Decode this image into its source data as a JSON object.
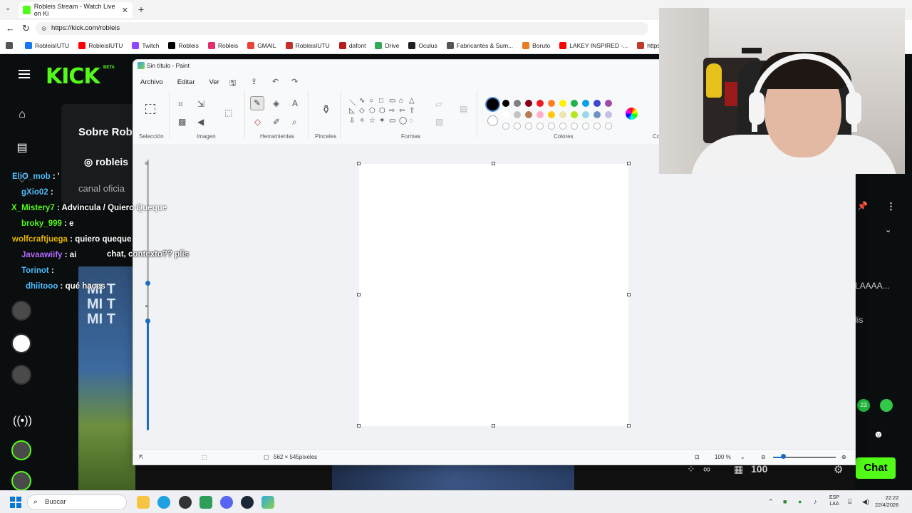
{
  "browser": {
    "tab_title": "Robleis Stream - Watch Live on Ki",
    "url": "https://kick.com/robleis",
    "bookmarks": [
      {
        "label": "RobleisIUTU",
        "color": "#1877f2"
      },
      {
        "label": "RobleisIUTU",
        "color": "#ff0000"
      },
      {
        "label": "Twitch",
        "color": "#9146ff"
      },
      {
        "label": "Robleis",
        "color": "#000000"
      },
      {
        "label": "Robleis",
        "color": "#e1306c"
      },
      {
        "label": "GMAIL",
        "color": "#ea4335"
      },
      {
        "label": "RobleisIUTU",
        "color": "#c4302b"
      },
      {
        "label": "dafont",
        "color": "#b71c1c"
      },
      {
        "label": "Drive",
        "color": "#34a853"
      },
      {
        "label": "Oculus",
        "color": "#1c1e21"
      },
      {
        "label": "Fabricantes & Sum...",
        "color": "#555555"
      },
      {
        "label": "Boruto",
        "color": "#e67e22"
      },
      {
        "label": "LAKEY INSPIRED -...",
        "color": "#ff0000"
      },
      {
        "label": "https://www",
        "color": "#c0392b"
      }
    ]
  },
  "kick": {
    "logo": "KICK",
    "beta": "BETA",
    "about_title": "Sobre Rob",
    "about_ig": "robleis",
    "about_desc": "canal oficia",
    "poster_lines": [
      "MI T",
      "MI T",
      "MI T"
    ],
    "chat": [
      {
        "user": "EliO_mob",
        "msg": ": '",
        "color": "#4dc0ff"
      },
      {
        "user": "gXio02",
        "msg": ":",
        "color": "#4dc0ff"
      },
      {
        "user": "X_Mistery7",
        "msg": ": Advincula / Quiero Queque",
        "color": "#53fc18"
      },
      {
        "user": "broky_999",
        "msg": ": e",
        "color": "#53fc18"
      },
      {
        "user": "wolfcraftjuega",
        "msg": ": quiero queque",
        "color": "#e6b800"
      },
      {
        "user": "Javaawiify",
        "msg": ": ai",
        "color": "#b46cff"
      },
      {
        "user": "Torinot",
        "msg": ":",
        "color": "#4dc0ff"
      },
      {
        "user": "dhiitooo",
        "msg": ": qué haces",
        "color": "#4dc0ff"
      }
    ],
    "overlay_msgs": [
      "chat, contexto?? plis"
    ],
    "right_text1": "LAAAA...",
    "right_text2": "lis",
    "emote_badge": "23",
    "viewer_count": "100",
    "chat_button": "Chat",
    "accent": "#53fc18"
  },
  "paint": {
    "title": "Sin título - Paint",
    "menus": [
      "Archivo",
      "Editar",
      "Ver"
    ],
    "group_labels": {
      "seleccion": "Selección",
      "imagen": "Imagen",
      "herramientas": "Herramientas",
      "pinceles": "Pinceles",
      "formas": "Formas",
      "colores": "Colores",
      "cut": "Co"
    },
    "palette_row1": [
      "#000000",
      "#7f7f7f",
      "#880015",
      "#ed1c24",
      "#ff7f27",
      "#fff200",
      "#22b14c",
      "#00a2e8",
      "#3f48cc",
      "#a349a4"
    ],
    "palette_row2": [
      "#ffffff",
      "#c3c3c3",
      "#b97a57",
      "#ffaec9",
      "#ffc90e",
      "#efe4b0",
      "#b5e61d",
      "#99d9ea",
      "#7092be",
      "#c8bfe7"
    ],
    "canvas_size": "562 × 545píxeles",
    "zoom": "100 %"
  },
  "taskbar": {
    "search_placeholder": "Buscar",
    "lang_line1": "ESP",
    "lang_line2": "LAA",
    "time": "22:22",
    "date": "22/4/2026"
  }
}
